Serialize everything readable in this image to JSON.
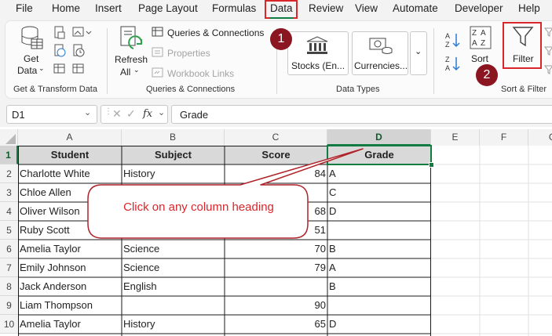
{
  "menu": {
    "items": [
      "File",
      "Home",
      "Insert",
      "Page Layout",
      "Formulas",
      "Data",
      "Review",
      "View",
      "Automate",
      "Developer",
      "Help"
    ]
  },
  "ribbon": {
    "get_data": {
      "line1": "Get",
      "line2": "Data"
    },
    "get_transform_label": "Get & Transform Data",
    "refresh": {
      "line1": "Refresh",
      "line2": "All"
    },
    "queries_connections": "Queries & Connections",
    "properties": "Properties",
    "workbook_links": "Workbook Links",
    "queries_group_label": "Queries & Connections",
    "stocks": "Stocks (En...",
    "currencies": "Currencies...",
    "data_types_label": "Data Types",
    "sort": "Sort",
    "filter": "Filter",
    "sort_filter_label": "Sort & Filter"
  },
  "badges": {
    "one": "1",
    "two": "2"
  },
  "formula_bar": {
    "name_box": "D1",
    "fx": "fx",
    "value": "Grade"
  },
  "columns": [
    "A",
    "B",
    "C",
    "D",
    "E",
    "F",
    "G"
  ],
  "rows": [
    "1",
    "2",
    "3",
    "4",
    "5",
    "6",
    "7",
    "8",
    "9",
    "10"
  ],
  "table": {
    "headers": [
      "Student",
      "Subject",
      "Score",
      "Grade"
    ],
    "rows": [
      [
        "Charlotte White",
        "History",
        "84",
        "A"
      ],
      [
        "Chloe Allen",
        "",
        "",
        "C"
      ],
      [
        "Oliver Wilson",
        "",
        "68",
        "D"
      ],
      [
        "Ruby Scott",
        "",
        "51",
        ""
      ],
      [
        "Amelia Taylor",
        "Science",
        "70",
        "B"
      ],
      [
        "Emily Johnson",
        "Science",
        "79",
        "A"
      ],
      [
        "Jack Anderson",
        "English",
        "",
        "B"
      ],
      [
        "Liam Thompson",
        "",
        "90",
        ""
      ],
      [
        "Amelia Taylor",
        "History",
        "65",
        "D"
      ]
    ]
  },
  "callout": {
    "text": "Click on any column heading"
  },
  "colors": {
    "accent_red": "#d9262b",
    "badge_red": "#8b1520",
    "excel_green": "#107c41",
    "header_fill": "#d9d9d9"
  }
}
